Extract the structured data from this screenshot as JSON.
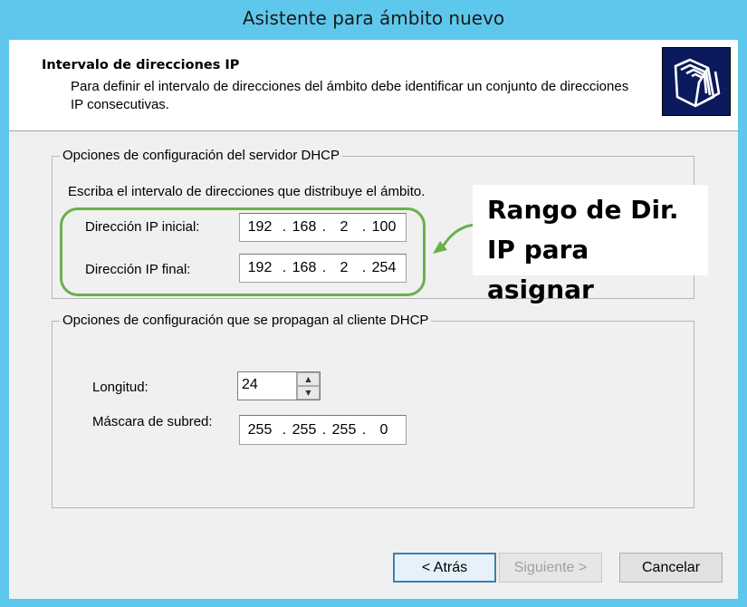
{
  "window": {
    "title": "Asistente para ámbito nuevo"
  },
  "header": {
    "title": "Intervalo de direcciones IP",
    "description": "Para definir el intervalo de direcciones del ámbito debe identificar un conjunto de direcciones IP consecutivas."
  },
  "server_group": {
    "label": "Opciones de configuración del servidor DHCP",
    "instruction": "Escriba el intervalo de direcciones que distribuye el ámbito.",
    "start_ip": {
      "label": "Dirección IP inicial:",
      "octets": [
        "192",
        "168",
        "2",
        "100"
      ]
    },
    "end_ip": {
      "label": "Dirección IP final:",
      "octets": [
        "192",
        "168",
        "2",
        "254"
      ]
    }
  },
  "client_group": {
    "label": "Opciones de configuración que se propagan al cliente DHCP",
    "length": {
      "label": "Longitud:",
      "value": "24"
    },
    "subnet": {
      "label": "Máscara de subred:",
      "octets": [
        "255",
        "255",
        "255",
        "0"
      ]
    }
  },
  "annotation": {
    "line1": "Rango de Dir.",
    "line2": "IP para asignar",
    "color": "#6ab04c"
  },
  "buttons": {
    "back": "< Atrás",
    "next": "Siguiente >",
    "cancel": "Cancelar"
  }
}
